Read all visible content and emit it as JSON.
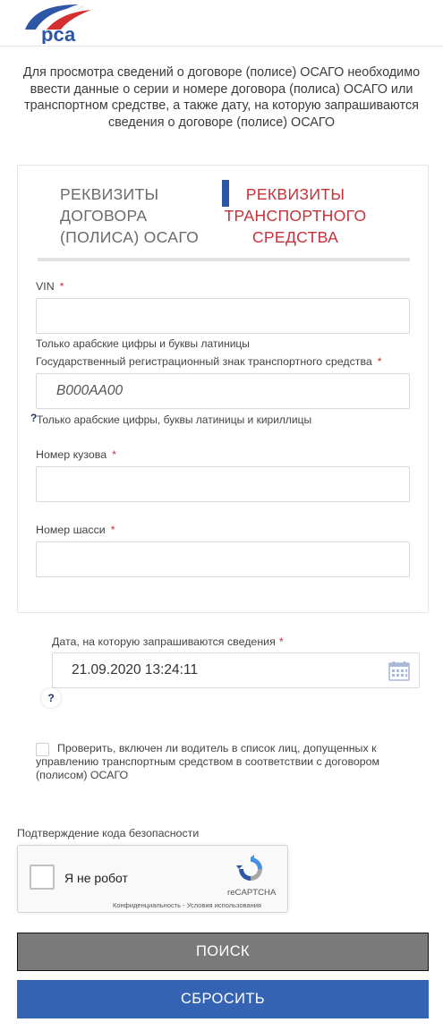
{
  "header": {
    "logo_text": "рса"
  },
  "intro": {
    "text": "Для просмотра сведений о договоре (полисе) ОСАГО необходимо ввести данные о серии и номере договора (полиса) ОСАГО или транспортном средстве, а также дату, на которую запрашиваются сведения о договоре (полисе) ОСАГО"
  },
  "tabs": [
    {
      "label": "РЕКВИЗИТЫ ДОГОВОРА (ПОЛИСА) ОСАГО",
      "active": false
    },
    {
      "label": "РЕКВИЗИТЫ ТРАНСПОРТНОГО СРЕДСТВА",
      "active": true
    }
  ],
  "form": {
    "vin": {
      "label": "VIN",
      "required": "*",
      "value": "",
      "hint": "Только арабские цифры и буквы латиницы"
    },
    "plate": {
      "label": "Государственный регистрационный знак транспортного средства",
      "required": "*",
      "placeholder": "В000АА00",
      "hint": "Только арабские цифры, буквы латиницы и кириллицы",
      "help": "?"
    },
    "body": {
      "label": "Номер кузова",
      "required": "*",
      "value": ""
    },
    "chassis": {
      "label": "Номер шасси",
      "required": "*",
      "value": ""
    }
  },
  "date": {
    "label": "Дата, на которую запрашиваются сведения",
    "required": "*",
    "value": "21.09.2020 13:24:11",
    "help": "?"
  },
  "driver_check": {
    "checked": false,
    "label": "Проверить, включен ли водитель в список лиц, допущенных к управлению транспортным средством в соответствии с договором (полисом) ОСАГО"
  },
  "captcha": {
    "label": "Подтверждение кода безопасности",
    "checkbox_text": "Я не робот",
    "brand": "reCAPTCHA",
    "links": "Конфиденциальность - Условия использования"
  },
  "buttons": {
    "search": "ПОИСК",
    "reset": "СБРОСИТЬ"
  },
  "colors": {
    "accent_red": "#c9313a",
    "accent_blue": "#3563b3",
    "search_button": "#7a7a7a"
  }
}
